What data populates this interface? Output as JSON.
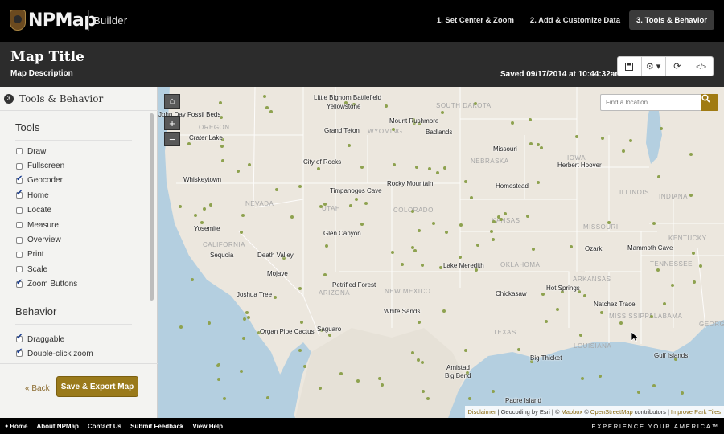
{
  "header": {
    "logo_text": "NPMap",
    "builder_label": "Builder",
    "steps": [
      {
        "label": "1. Set Center & Zoom",
        "active": false
      },
      {
        "label": "2. Add & Customize Data",
        "active": false
      },
      {
        "label": "3. Tools & Behavior",
        "active": true
      }
    ]
  },
  "titlebar": {
    "map_title": "Map Title",
    "map_description": "Map Description",
    "saved_text": "Saved 09/17/2014 at 10:44:32am",
    "buttons": [
      {
        "icon": "save-icon",
        "glyph": "🖫"
      },
      {
        "icon": "gear-icon",
        "glyph": "⚙ ▾"
      },
      {
        "icon": "refresh-icon",
        "glyph": "⟳"
      },
      {
        "icon": "code-icon",
        "glyph": "</>"
      }
    ]
  },
  "sidebar": {
    "step_number": "3",
    "title": "Tools & Behavior",
    "tools_heading": "Tools",
    "tools": [
      {
        "label": "Draw",
        "checked": false
      },
      {
        "label": "Fullscreen",
        "checked": false
      },
      {
        "label": "Geocoder",
        "checked": true
      },
      {
        "label": "Home",
        "checked": true
      },
      {
        "label": "Locate",
        "checked": false
      },
      {
        "label": "Measure",
        "checked": false
      },
      {
        "label": "Overview",
        "checked": false
      },
      {
        "label": "Print",
        "checked": false
      },
      {
        "label": "Scale",
        "checked": false
      },
      {
        "label": "Zoom Buttons",
        "checked": true
      }
    ],
    "behavior_heading": "Behavior",
    "behavior": [
      {
        "label": "Draggable",
        "checked": true
      },
      {
        "label": "Double-click zoom",
        "checked": true
      }
    ],
    "back_label": "« Back",
    "save_export_label": "Save & Export Map"
  },
  "map": {
    "search_placeholder": "Find a location",
    "controls": {
      "home": "⌂",
      "zoom_in": "+",
      "zoom_out": "−"
    },
    "parks": [
      "Little Bighorn Battlefield",
      "Yellowstone",
      "John Day Fossil Beds",
      "Crater Lake",
      "Mount Rushmore",
      "Badlands",
      "Grand Teton",
      "Missouri",
      "Herbert Hoover",
      "City of Rocks",
      "Whiskeytown",
      "Timpanogos Cave",
      "Rocky Mountain",
      "Homestead",
      "Yosemite",
      "Glen Canyon",
      "Mammoth Cave",
      "Sequoia",
      "Death Valley",
      "Ozark",
      "Lake Meredith",
      "Mojave",
      "Petrified Forest",
      "Hot Springs",
      "Chickasaw",
      "Joshua Tree",
      "Natchez Trace",
      "White Sands",
      "Organ Pipe Cactus",
      "Saguaro",
      "Gulf Islands",
      "Big Thicket",
      "Amistad",
      "Big Bend",
      "Padre Island"
    ],
    "states": [
      "SOUTH DAKOTA",
      "OREGON",
      "WYOMING",
      "NEBRASKA",
      "IOWA",
      "NEVADA",
      "UTAH",
      "COLORADO",
      "ILLINOIS",
      "INDIANA",
      "KANSAS",
      "CALIFORNIA",
      "MISSOURI",
      "KENTUCKY",
      "OKLAHOMA",
      "TENNESSEE",
      "ARKANSAS",
      "ARIZONA",
      "NEW MEXICO",
      "MISSISSIPPI",
      "ALABAMA",
      "GEORGIA",
      "TEXAS",
      "LOUISIANA"
    ],
    "attribution": {
      "disclaimer": "Disclaimer",
      "geocoding": "| Geocoding by Esri | ©",
      "mapbox": "Mapbox",
      "copy": "©",
      "osm": "OpenStreetMap",
      "contributors": "contributors |",
      "improve": "Improve Park Tiles"
    }
  },
  "footer": {
    "links": [
      "Home",
      "About NPMap",
      "Contact Us",
      "Submit Feedback",
      "View Help"
    ],
    "tagline": "EXPERIENCE YOUR AMERICA™"
  },
  "colors": {
    "accent": "#9a7a1b",
    "nav_bg": "#000000",
    "titlebar_bg": "#2c2c2c",
    "map_land": "#ece7de",
    "map_water": "#b4cfe0",
    "park_dot": "#8ea24f"
  }
}
